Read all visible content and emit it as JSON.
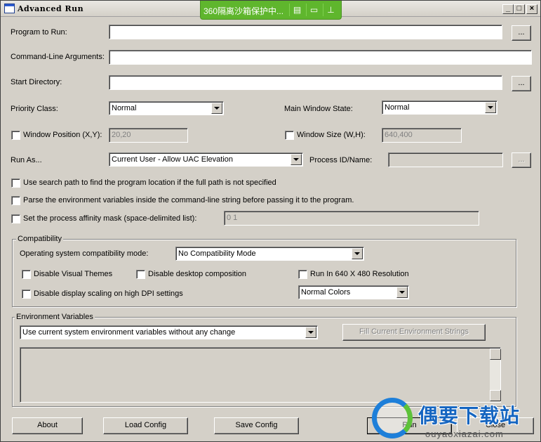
{
  "window": {
    "title": "Advanced Run"
  },
  "sandbox": {
    "text": "360隔离沙箱保护中..."
  },
  "fields": {
    "program_label": "Program to Run:",
    "program_value": "",
    "args_label": "Command-Line Arguments:",
    "args_value": "",
    "startdir_label": "Start Directory:",
    "startdir_value": "",
    "browse_label": "...",
    "priority_label": "Priority Class:",
    "priority_value": "Normal",
    "winstate_label": "Main Window State:",
    "winstate_value": "Normal",
    "winpos_label": "Window Position (X,Y):",
    "winpos_value": "20,20",
    "winsize_label": "Window Size (W,H):",
    "winsize_value": "640,400",
    "runas_label": "Run As...",
    "runas_value": "Current User - Allow UAC Elevation",
    "pid_label": "Process ID/Name:",
    "pid_value": "",
    "searchpath_label": "Use search path to find the program location if the full path is not specified",
    "parseenv_label": "Parse the environment variables inside the command-line string before passing it to the program.",
    "affinity_label": "Set the process affinity mask (space-delimited list):",
    "affinity_value": "0 1"
  },
  "compat": {
    "title": "Compatibility",
    "os_label": "Operating system compatibility mode:",
    "os_value": "No Compatibility Mode",
    "themes_label": "Disable Visual Themes",
    "desktop_label": "Disable desktop composition",
    "res_label": "Run In 640 X 480 Resolution",
    "dpi_label": "Disable display scaling on high DPI settings",
    "colors_value": "Normal Colors"
  },
  "env": {
    "title": "Environment Variables",
    "mode_value": "Use current system environment variables without any change",
    "fill_label": "Fill Current Environment Strings"
  },
  "buttons": {
    "about": "About",
    "load": "Load Config",
    "save": "Save Config",
    "run": "Run",
    "close": "Close"
  },
  "watermark": {
    "title": "偶要下载站",
    "url": "ouyaoxiazai.com"
  }
}
